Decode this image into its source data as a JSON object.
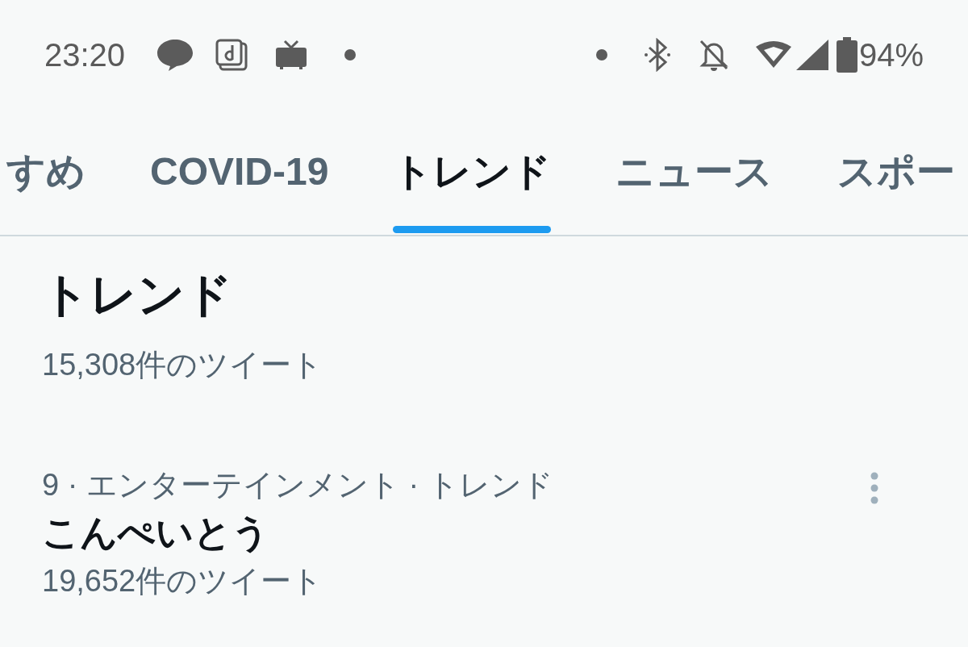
{
  "status_bar": {
    "time": "23:20",
    "battery": "94%"
  },
  "tabs": [
    {
      "label": "すめ",
      "selected": false
    },
    {
      "label": "COVID-19",
      "selected": false
    },
    {
      "label": "トレンド",
      "selected": true
    },
    {
      "label": "ニュース",
      "selected": false
    },
    {
      "label": "スポー",
      "selected": false
    }
  ],
  "trends": [
    {
      "name": "トレンド",
      "count": "15,308件のツイート"
    },
    {
      "meta": "9 · エンターテインメント · トレンド",
      "name": "こんぺいとう",
      "count": "19,652件のツイート"
    }
  ]
}
